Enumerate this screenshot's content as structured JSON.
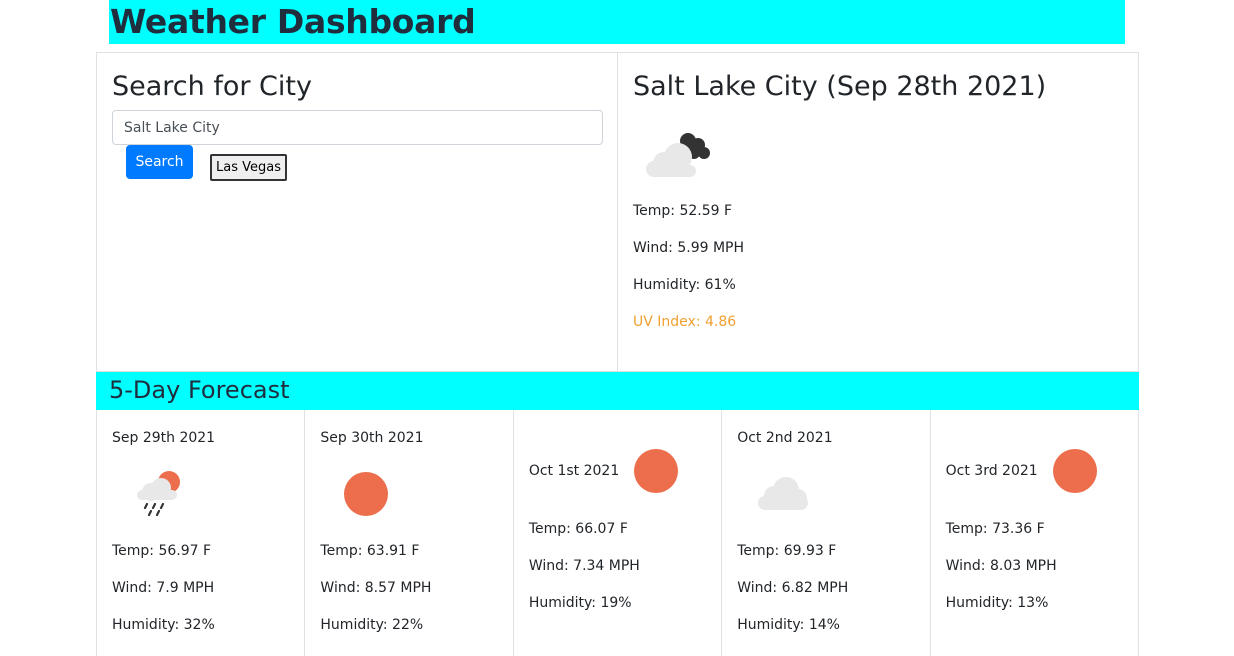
{
  "header": {
    "title": "Weather Dashboard"
  },
  "search": {
    "heading": "Search for City",
    "input_value": "Salt Lake City",
    "button_label": "Search",
    "history": [
      "Las Vegas"
    ]
  },
  "current": {
    "heading": "Salt Lake City (Sep 28th 2021)",
    "icon": "partly-cloudy-night-icon",
    "temp": "Temp: 52.59 F",
    "wind": "Wind: 5.99 MPH",
    "humidity": "Humidity: 61%",
    "uv": "UV Index: 4.86",
    "uv_color": "#f0a030"
  },
  "forecast": {
    "heading": "5-Day Forecast",
    "days": [
      {
        "date": "Sep 29th 2021",
        "icon": "rain-sun-icon",
        "temp": "Temp: 56.97 F",
        "wind": "Wind: 7.9 MPH",
        "humidity": "Humidity: 32%"
      },
      {
        "date": "Sep 30th 2021",
        "icon": "sun-icon",
        "temp": "Temp: 63.91 F",
        "wind": "Wind: 8.57 MPH",
        "humidity": "Humidity: 22%"
      },
      {
        "date": "Oct 1st 2021",
        "icon": "sun-icon",
        "temp": "Temp: 66.07 F",
        "wind": "Wind: 7.34 MPH",
        "humidity": "Humidity: 19%"
      },
      {
        "date": "Oct 2nd 2021",
        "icon": "cloud-icon",
        "temp": "Temp: 69.93 F",
        "wind": "Wind: 6.82 MPH",
        "humidity": "Humidity: 14%"
      },
      {
        "date": "Oct 3rd 2021",
        "icon": "sun-icon",
        "temp": "Temp: 73.36 F",
        "wind": "Wind: 8.03 MPH",
        "humidity": "Humidity: 13%"
      }
    ]
  },
  "colors": {
    "accent_banner": "#00ffff",
    "primary_button": "#007bff",
    "sun": "#ec6e4c"
  }
}
